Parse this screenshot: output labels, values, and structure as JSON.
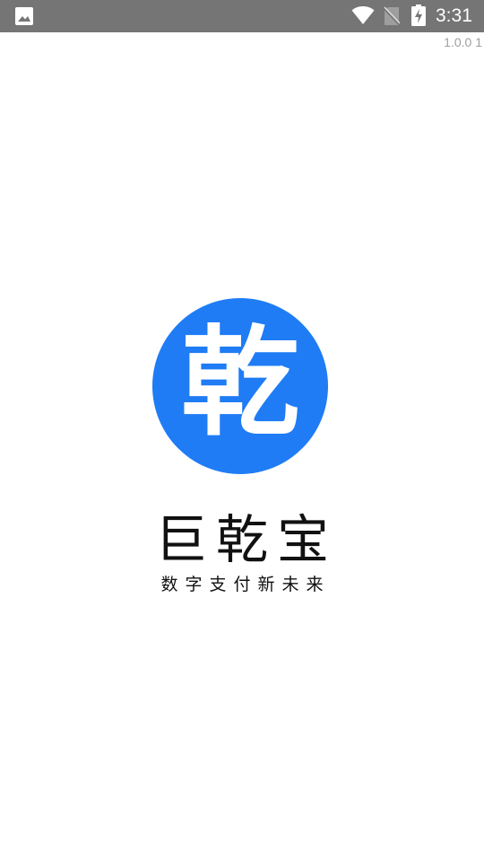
{
  "status_bar": {
    "time": "3:31",
    "icons": [
      "gallery-icon",
      "wifi-icon",
      "no-sim-icon",
      "battery-charging-icon"
    ],
    "background_color": "#757575"
  },
  "version": "1.0.0 1",
  "logo": {
    "glyph": "乾",
    "color": "#1f7cf5"
  },
  "app_name": "巨乾宝",
  "tagline": "数字支付新未来"
}
